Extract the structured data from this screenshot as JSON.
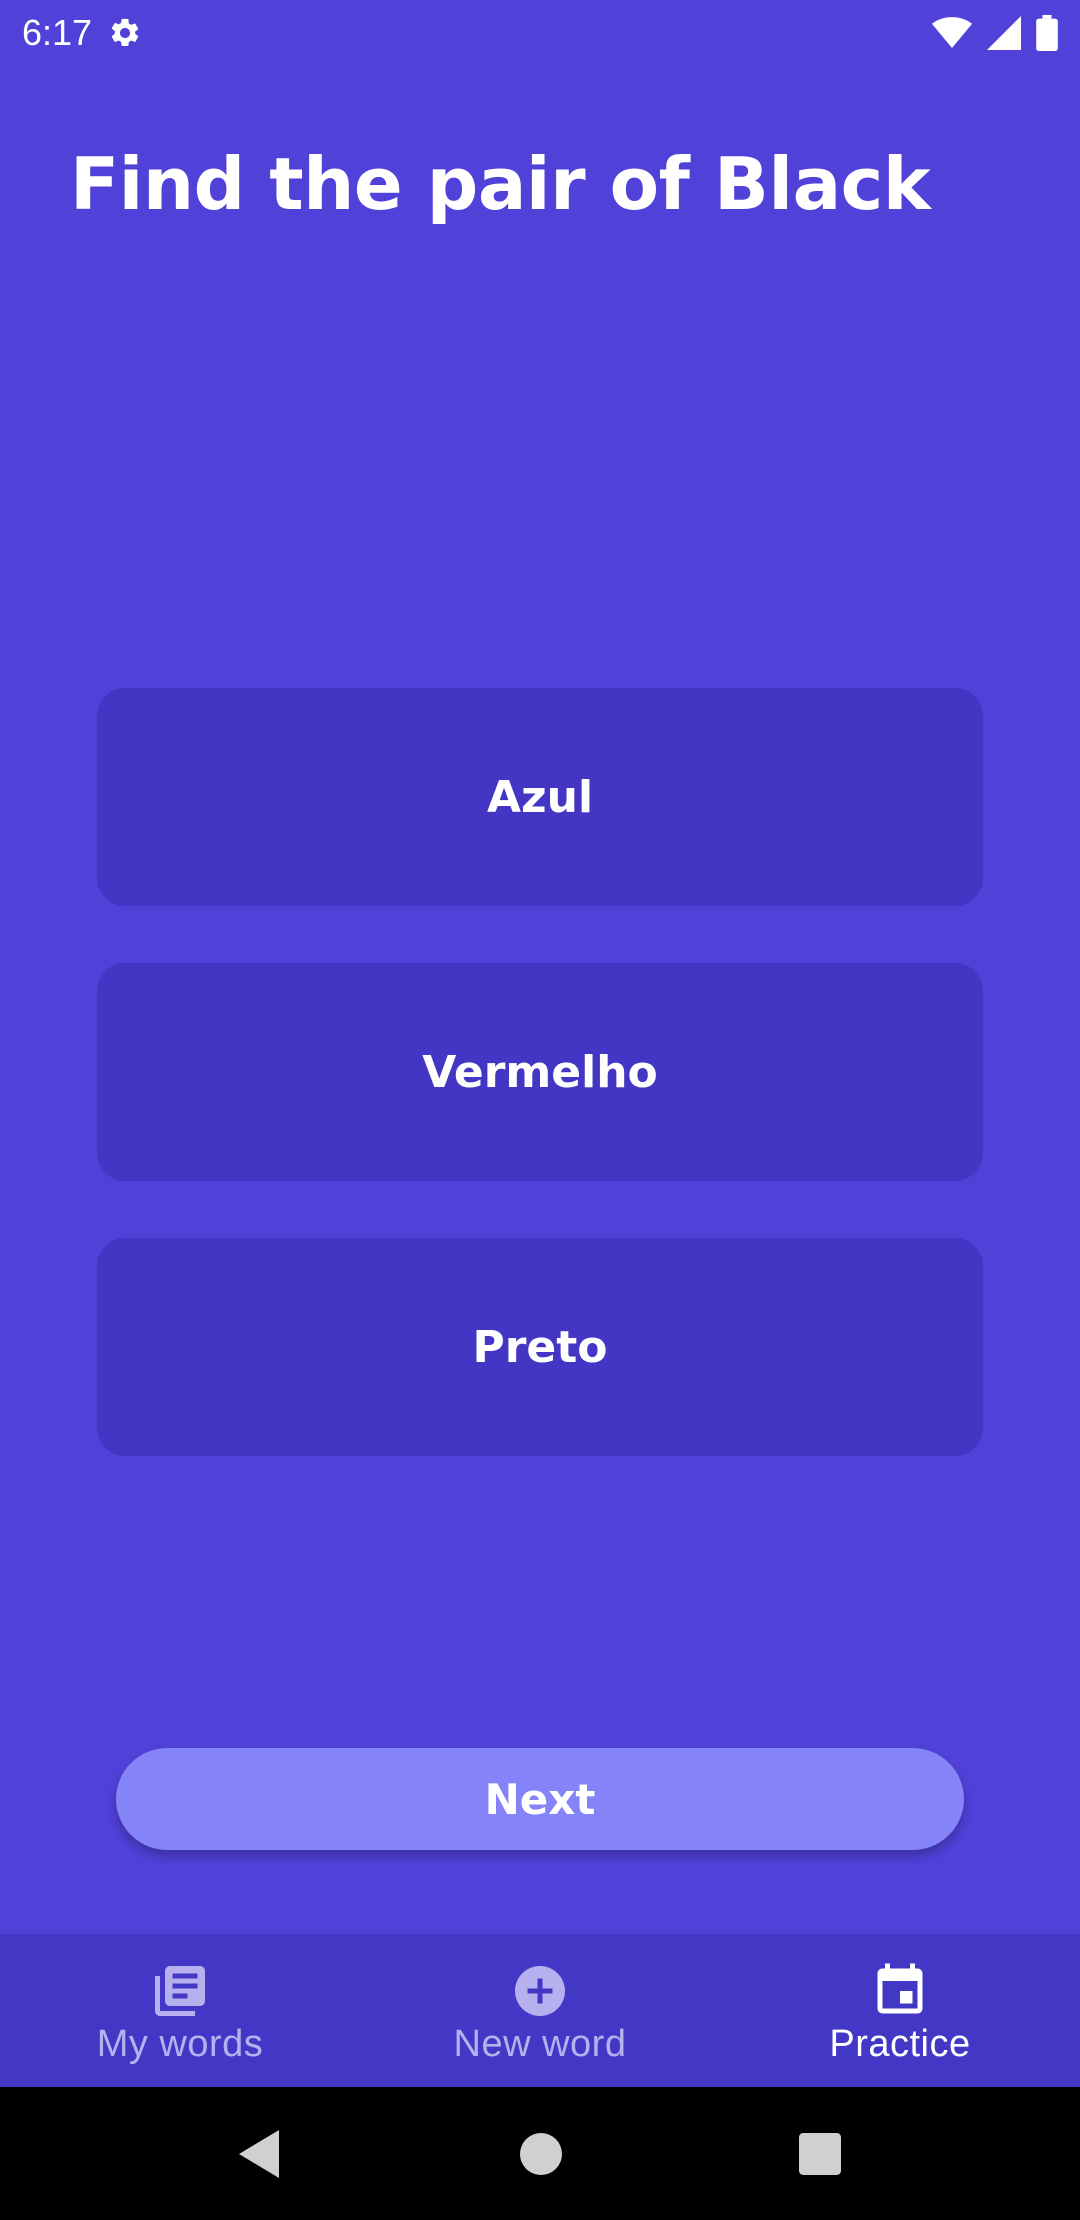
{
  "status_bar": {
    "time": "6:17",
    "icons": [
      "settings-icon",
      "wifi-icon",
      "signal-icon",
      "battery-icon"
    ]
  },
  "page": {
    "title": "Find the pair of Black"
  },
  "options": [
    {
      "label": "Azul"
    },
    {
      "label": "Vermelho"
    },
    {
      "label": "Preto"
    }
  ],
  "next_button": {
    "label": "Next"
  },
  "bottom_nav": {
    "items": [
      {
        "label": "My words",
        "icon": "list-icon",
        "active": false
      },
      {
        "label": "New word",
        "icon": "add-circle-icon",
        "active": false
      },
      {
        "label": "Practice",
        "icon": "calendar-icon",
        "active": true
      }
    ]
  },
  "system_nav": {
    "buttons": [
      "back-icon",
      "home-icon",
      "recents-icon"
    ]
  },
  "colors": {
    "background": "#5041D9",
    "option_background": "#4336C4",
    "next_button": "#8583F8",
    "bottom_nav_background": "#4337C6",
    "nav_inactive": "#B6B1EE",
    "nav_active": "#FFFFFF"
  }
}
